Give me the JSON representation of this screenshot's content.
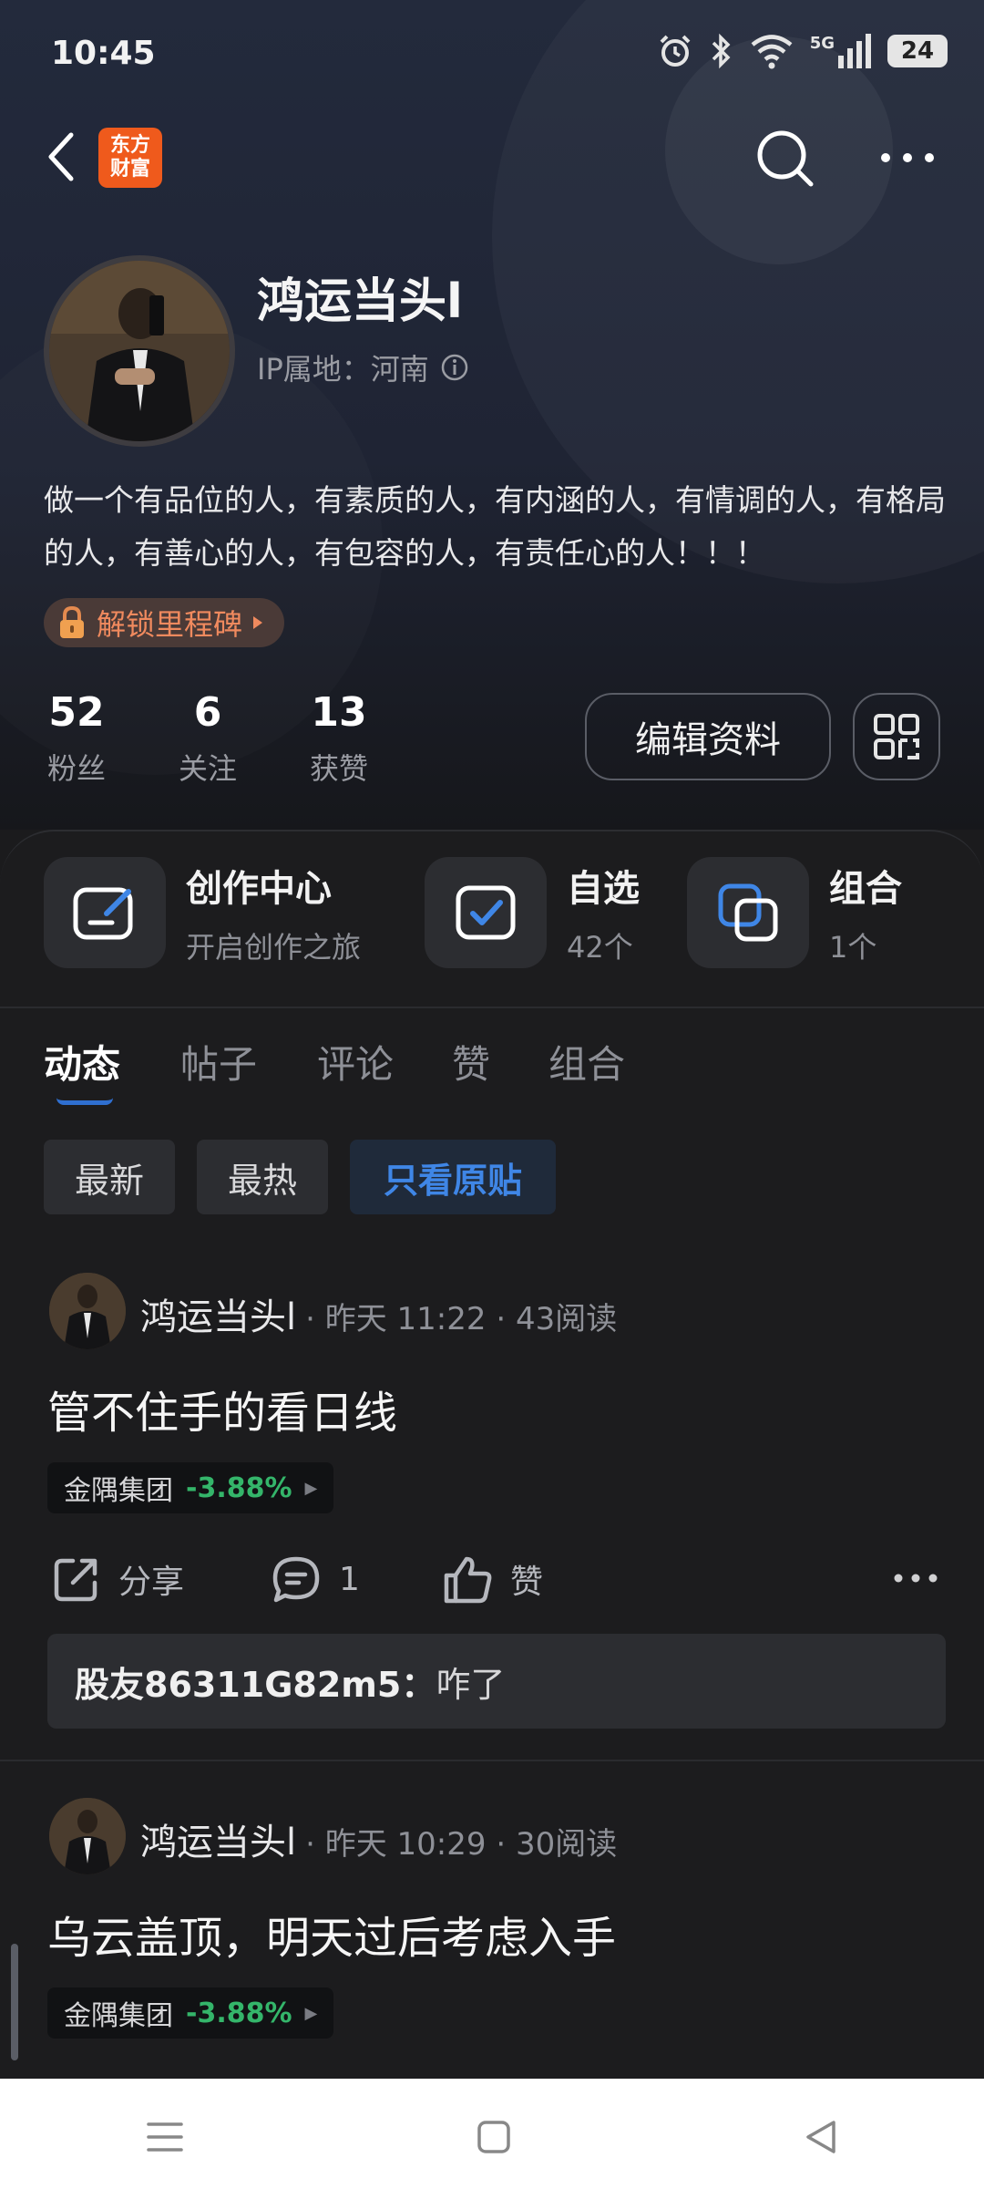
{
  "status_bar": {
    "time": "10:45",
    "network": "5G",
    "battery": "24"
  },
  "header": {
    "logo_text": "东方财富"
  },
  "profile": {
    "name": "鸿运当头l",
    "ip_location": "IP属地：河南",
    "bio": "做一个有品位的人，有素质的人，有内涵的人，有情调的人，有格局的人，有善心的人，有包容的人，有责任心的人！！！",
    "milestone_label": "解锁里程碑",
    "stats": [
      {
        "value": "52",
        "label": "粉丝"
      },
      {
        "value": "6",
        "label": "关注"
      },
      {
        "value": "13",
        "label": "获赞"
      }
    ],
    "edit_label": "编辑资料"
  },
  "tools": [
    {
      "title": "创作中心",
      "subtitle": "开启创作之旅",
      "icon": "create-icon"
    },
    {
      "title": "自选",
      "subtitle": "42个",
      "icon": "watchlist-icon"
    },
    {
      "title": "组合",
      "subtitle": "1个",
      "icon": "portfolio-icon"
    }
  ],
  "tabs": [
    "动态",
    "帖子",
    "评论",
    "赞",
    "组合"
  ],
  "active_tab": "动态",
  "filters": [
    "最新",
    "最热",
    "只看原贴"
  ],
  "posts": [
    {
      "author": "鸿运当头l",
      "meta": "· 昨天 11:22 · 43阅读",
      "title": "管不住手的看日线",
      "stock_name": "金隅集团",
      "stock_change": "-3.88%",
      "share_label": "分享",
      "comment_count": "1",
      "like_label": "赞",
      "comment": {
        "user": "股友86311G82m5：",
        "text": "咋了"
      }
    },
    {
      "author": "鸿运当头l",
      "meta": "· 昨天 10:29 · 30阅读",
      "title": "乌云盖顶，明天过后考虑入手",
      "stock_name": "金隅集团",
      "stock_change": "-3.88%"
    }
  ],
  "colors": {
    "accent_blue": "#3f86e6",
    "stock_green": "#34b56a",
    "milestone_orange": "#f08a5e",
    "logo_orange": "#ef5a1c"
  }
}
